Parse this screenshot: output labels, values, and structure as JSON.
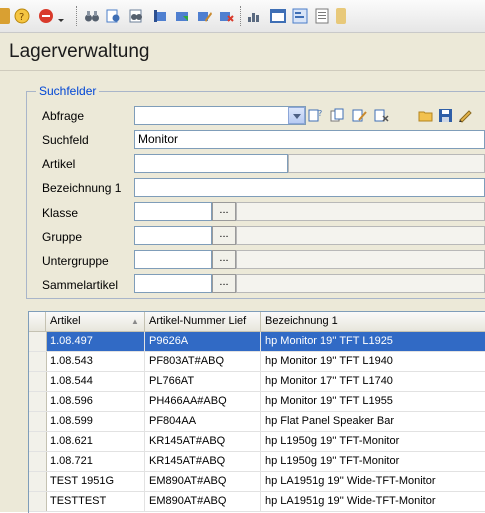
{
  "window": {
    "title": "Lagerverwaltung"
  },
  "toolbar": {
    "icons": [
      "partial-icon",
      "help-icon",
      "stop-icon",
      "dropdown-arrow-icon",
      "binoculars-icon",
      "find-replace-icon",
      "find-all-icon",
      "record-first-icon",
      "record-next-icon",
      "record-edit-icon",
      "record-delete-icon",
      "chart-icon",
      "window-icon",
      "form-icon",
      "report-icon",
      "partial-right-icon"
    ]
  },
  "search": {
    "legend": "Suchfelder",
    "labels": {
      "abfrage": "Abfrage",
      "suchfeld": "Suchfeld",
      "artikel": "Artikel",
      "bezeichnung": "Bezeichnung 1",
      "klasse": "Klasse",
      "gruppe": "Gruppe",
      "untergruppe": "Untergruppe",
      "sammelartikel": "Sammelartikel"
    },
    "values": {
      "abfrage": "",
      "suchfeld": "Monitor",
      "artikel": "",
      "bezeichnung": "",
      "klasse": "",
      "gruppe": "",
      "untergruppe": "",
      "sammelartikel": ""
    },
    "dots": "...",
    "query_icons": [
      "query-new-icon",
      "query-copy-icon",
      "query-edit-icon",
      "query-delete-icon",
      "open-folder-icon",
      "save-icon",
      "pencil-icon"
    ]
  },
  "grid": {
    "columns": [
      "Artikel",
      "Artikel-Nummer Lief",
      "Bezeichnung 1"
    ],
    "sort_column": 0,
    "selected_row": 0,
    "rows": [
      [
        "1.08.497",
        "P9626A",
        "hp Monitor 19'' TFT L1925"
      ],
      [
        "1.08.543",
        "PF803AT#ABQ",
        "hp Monitor 19'' TFT L1940"
      ],
      [
        "1.08.544",
        "PL766AT",
        "hp Monitor 17'' TFT L1740"
      ],
      [
        "1.08.596",
        "PH466AA#ABQ",
        "hp Monitor 19'' TFT L1955"
      ],
      [
        "1.08.599",
        "PF804AA",
        "hp Flat Panel Speaker Bar"
      ],
      [
        "1.08.621",
        "KR145AT#ABQ",
        "hp L1950g 19'' TFT-Monitor"
      ],
      [
        "1.08.721",
        "KR145AT#ABQ",
        "hp L1950g 19'' TFT-Monitor"
      ],
      [
        "TEST 1951G",
        "EM890AT#ABQ",
        "hp LA1951g 19'' Wide-TFT-Monitor"
      ],
      [
        "TESTTEST",
        "EM890AT#ABQ",
        "hp LA1951g 19'' Wide-TFT-Monitor"
      ]
    ]
  }
}
